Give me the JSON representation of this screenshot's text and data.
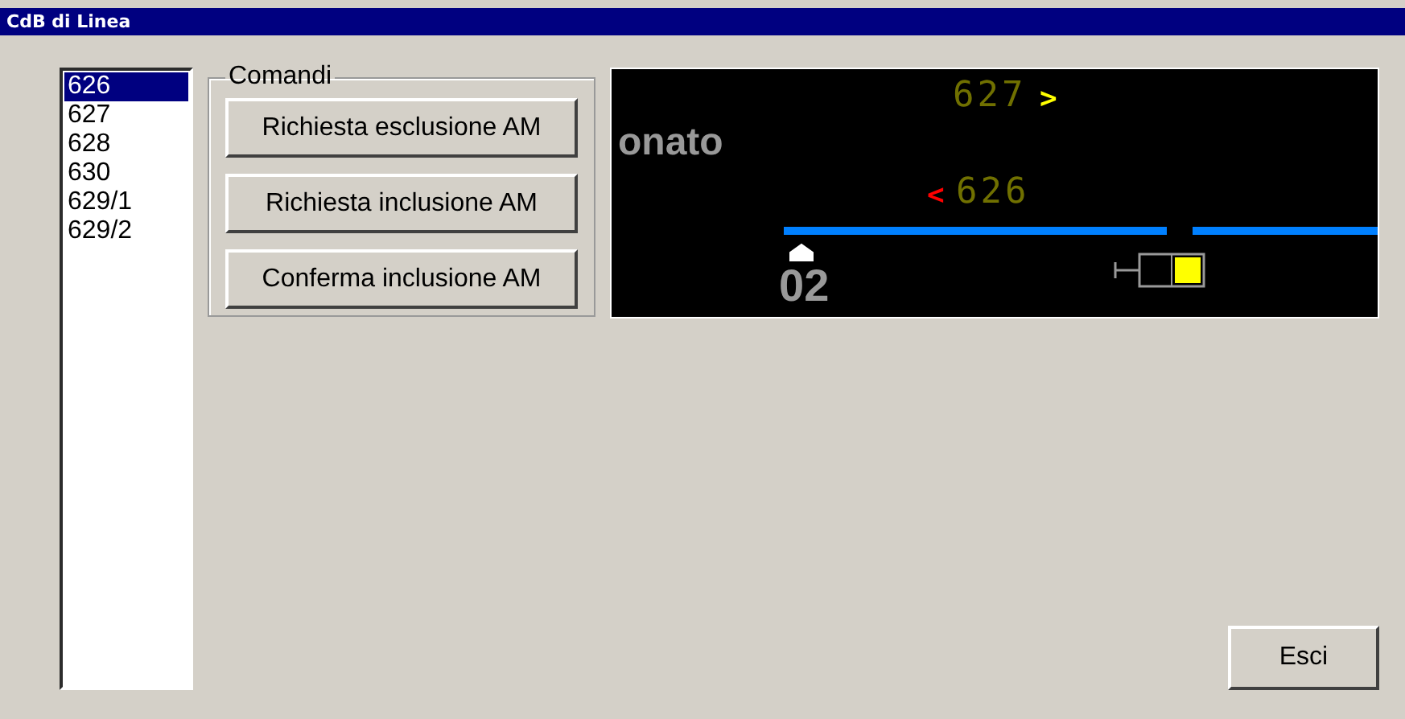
{
  "window": {
    "title": "CdB di Linea"
  },
  "list": [
    {
      "label": "626",
      "selected": true
    },
    {
      "label": "627",
      "selected": false
    },
    {
      "label": "628",
      "selected": false
    },
    {
      "label": "630",
      "selected": false
    },
    {
      "label": "629/1",
      "selected": false
    },
    {
      "label": "629/2",
      "selected": false
    }
  ],
  "commands": {
    "title": "Comandi",
    "buttons": [
      "Richiesta esclusione AM",
      "Richiesta inclusione AM",
      "Conferma inclusione AM"
    ]
  },
  "diagram": {
    "station": "onato",
    "upper": {
      "number": "627",
      "arrow": ">",
      "color": "#ffff00"
    },
    "lower": {
      "number": "626",
      "arrow": "<",
      "color": "#ff0000"
    },
    "platform": "02"
  },
  "exit_button": "Esci"
}
